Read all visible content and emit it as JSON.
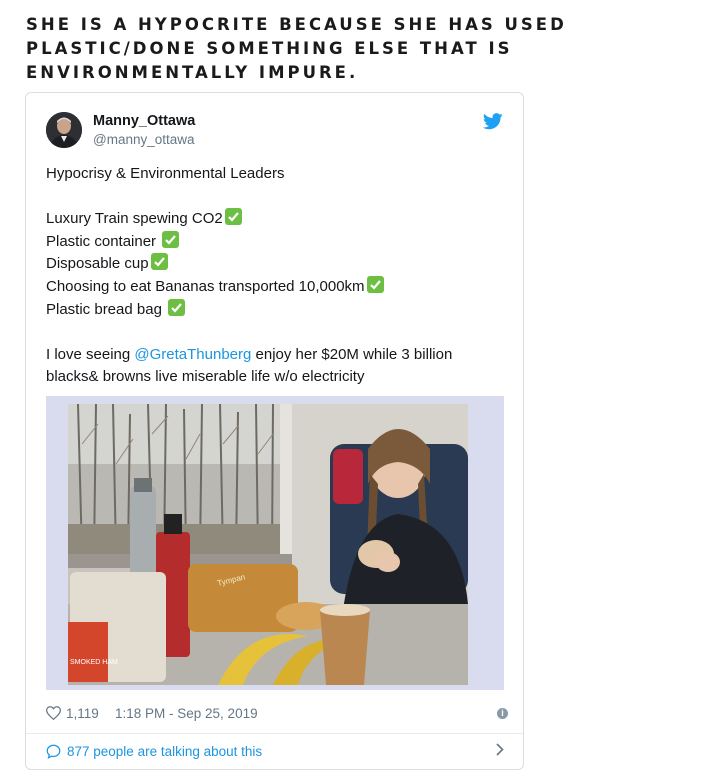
{
  "headline": "SHE IS A HYPOCRITE BECAUSE SHE HAS USED PLASTIC/DONE SOMETHING ELSE THAT IS ENVIRONMENTALLY IMPURE.",
  "tweet": {
    "display_name": "Manny_Ottawa",
    "handle": "@manny_ottawa",
    "line_title": "Hypocrisy & Environmental Leaders",
    "checklist": [
      "Luxury Train spewing CO2",
      "Plastic container ",
      "Disposable cup",
      "Choosing to eat Bananas transported 10,000km",
      "Plastic bread bag "
    ],
    "closing_before": "I love seeing ",
    "mention": "@GretaThunberg",
    "closing_after": " enjoy her $20M while 3 billion",
    "closing_line2": "blacks& browns live miserable life w/o electricity",
    "likes": "1,119",
    "timestamp": "1:18 PM - Sep 25, 2019",
    "talking": "877 people are talking about this"
  },
  "colors": {
    "link": "#1b95e0",
    "twitter_blue": "#1da1f2",
    "check_green": "#6cbf42",
    "muted": "#657786"
  },
  "icons": {
    "brand": "twitter-bird-icon",
    "like": "heart-icon",
    "info": "info-icon",
    "reply": "speech-bubble-icon",
    "more": "chevron-right-icon",
    "check": "check-mark-icon"
  },
  "photo_text": {
    "jar_label": "SMOKED HAM",
    "bread_bag_label": "Tympan"
  }
}
